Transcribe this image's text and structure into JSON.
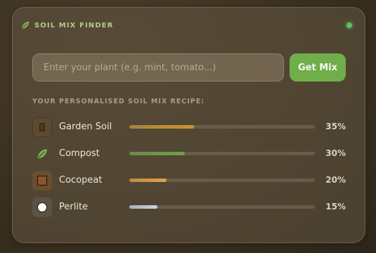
{
  "header": {
    "title": "SOIL MIX FINDER",
    "icon": "leaf-icon",
    "status_color": "#5fbf62"
  },
  "search": {
    "placeholder": "Enter your plant (e.g. mint, tomato...)",
    "value": "",
    "button_label": "Get Mix",
    "button_color": "#6fae4b"
  },
  "recipe": {
    "label": "YOUR PERSONALISED SOIL MIX RECIPE:",
    "items": [
      {
        "name": "Garden Soil",
        "percent_label": "35%",
        "percent": 35,
        "icon": "soil-bag-icon",
        "color": "#c99436"
      },
      {
        "name": "Compost",
        "percent_label": "30%",
        "percent": 30,
        "icon": "leaf-icon",
        "color": "#6fa04a"
      },
      {
        "name": "Cocopeat",
        "percent_label": "20%",
        "percent": 20,
        "icon": "brown-square-icon",
        "color": "#e0a14a"
      },
      {
        "name": "Perlite",
        "percent_label": "15%",
        "percent": 15,
        "icon": "white-circle-icon",
        "color": "#c8d6e6"
      }
    ]
  }
}
